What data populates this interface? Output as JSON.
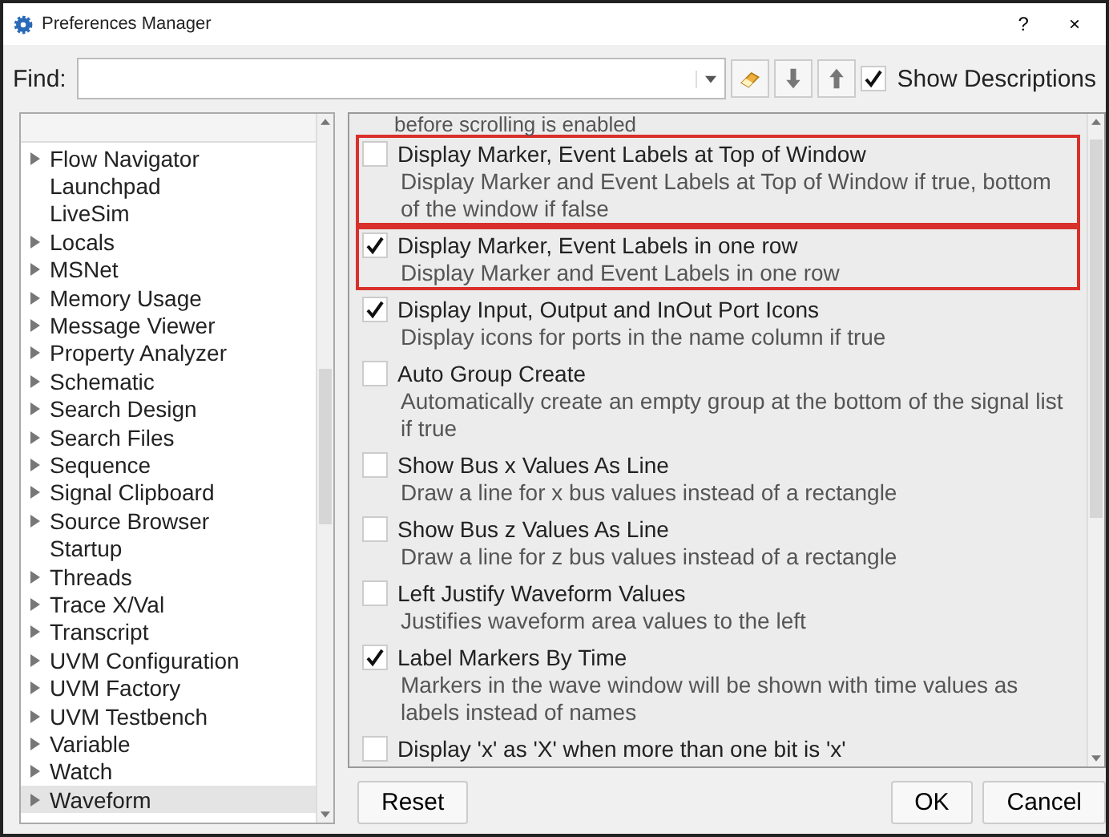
{
  "window": {
    "title": "Preferences Manager",
    "help": "?",
    "close": "×"
  },
  "find": {
    "label": "Find:",
    "show_descriptions": {
      "label": "Show Descriptions",
      "checked": true
    }
  },
  "sidebar": {
    "items": [
      {
        "label": "Flow Navigator",
        "expandable": true,
        "selected": false
      },
      {
        "label": "Launchpad",
        "expandable": false,
        "selected": false
      },
      {
        "label": "LiveSim",
        "expandable": false,
        "selected": false
      },
      {
        "label": "Locals",
        "expandable": true,
        "selected": false
      },
      {
        "label": "MSNet",
        "expandable": true,
        "selected": false
      },
      {
        "label": "Memory Usage",
        "expandable": true,
        "selected": false
      },
      {
        "label": "Message Viewer",
        "expandable": true,
        "selected": false
      },
      {
        "label": "Property Analyzer",
        "expandable": true,
        "selected": false
      },
      {
        "label": "Schematic",
        "expandable": true,
        "selected": false
      },
      {
        "label": "Search Design",
        "expandable": true,
        "selected": false
      },
      {
        "label": "Search Files",
        "expandable": true,
        "selected": false
      },
      {
        "label": "Sequence",
        "expandable": true,
        "selected": false
      },
      {
        "label": "Signal Clipboard",
        "expandable": true,
        "selected": false
      },
      {
        "label": "Source Browser",
        "expandable": true,
        "selected": false
      },
      {
        "label": "Startup",
        "expandable": false,
        "selected": false
      },
      {
        "label": "Threads",
        "expandable": true,
        "selected": false
      },
      {
        "label": "Trace X/Val",
        "expandable": true,
        "selected": false
      },
      {
        "label": "Transcript",
        "expandable": true,
        "selected": false
      },
      {
        "label": "UVM Configuration",
        "expandable": true,
        "selected": false
      },
      {
        "label": "UVM Factory",
        "expandable": true,
        "selected": false
      },
      {
        "label": "UVM Testbench",
        "expandable": true,
        "selected": false
      },
      {
        "label": "Variable",
        "expandable": true,
        "selected": false
      },
      {
        "label": "Watch",
        "expandable": true,
        "selected": false
      },
      {
        "label": "Waveform",
        "expandable": true,
        "selected": true
      }
    ]
  },
  "preferences": {
    "top_cut_text": "before scrolling is enabled",
    "items": [
      {
        "label": "Display Marker, Event Labels at Top of Window",
        "description": "Display Marker and Event Labels at Top of Window if true, bottom of the window if false",
        "checked": false,
        "highlighted": true
      },
      {
        "label": "Display Marker, Event Labels in one row",
        "description": "Display Marker and Event Labels in one row",
        "checked": true,
        "highlighted": true
      },
      {
        "label": "Display Input, Output and InOut Port Icons",
        "description": "Display icons for ports in the name column if true",
        "checked": true,
        "highlighted": false
      },
      {
        "label": "Auto Group Create",
        "description": "Automatically create an empty group at the bottom of the signal list if true",
        "checked": false,
        "highlighted": false
      },
      {
        "label": "Show Bus x Values As Line",
        "description": "Draw a line for x bus values instead of a rectangle",
        "checked": false,
        "highlighted": false
      },
      {
        "label": "Show Bus z Values As Line",
        "description": "Draw a line for z bus values instead of a rectangle",
        "checked": false,
        "highlighted": false
      },
      {
        "label": "Left Justify Waveform Values",
        "description": "Justifies waveform area values to the left",
        "checked": false,
        "highlighted": false
      },
      {
        "label": "Label Markers By Time",
        "description": "Markers in the wave window will be shown with time values as labels instead of names",
        "checked": true,
        "highlighted": false
      },
      {
        "label": "Display 'x' as 'X' when more than one bit is 'x'",
        "checked": false,
        "highlighted": false
      }
    ]
  },
  "buttons": {
    "reset": "Reset",
    "ok": "OK",
    "cancel": "Cancel"
  }
}
